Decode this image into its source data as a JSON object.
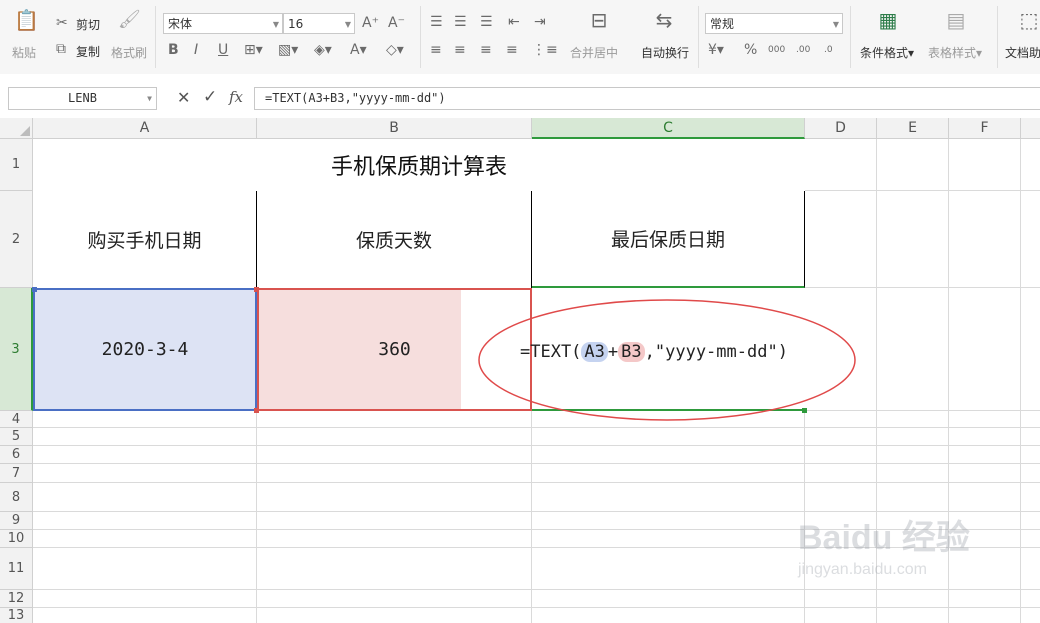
{
  "ribbon": {
    "clipboard": {
      "paste": "粘贴",
      "cut": "剪切",
      "copy": "复制",
      "format_painter": "格式刷"
    },
    "font": {
      "name": "宋体",
      "size": "16"
    },
    "alignment": {
      "merge": "合并居中",
      "wrap": "自动换行"
    },
    "number": {
      "format": "常规"
    },
    "styles": {
      "conditional": "条件格式",
      "table_style": "表格样式",
      "doc": "文档助"
    }
  },
  "formula_bar": {
    "name_box": "LENB",
    "formula": "=TEXT(A3+B3,\"yyyy-mm-dd\")"
  },
  "columns": [
    "A",
    "B",
    "C",
    "D",
    "E",
    "F"
  ],
  "rows": [
    "1",
    "2",
    "3",
    "4",
    "5",
    "6",
    "7",
    "8",
    "9",
    "10",
    "11",
    "12",
    "13"
  ],
  "sheet": {
    "title": "手机保质期计算表",
    "headers": [
      "购买手机日期",
      "保质天数",
      "最后保质日期"
    ],
    "a3": "2020-3-4",
    "b3": "360",
    "c3": {
      "prefix": "=TEXT(",
      "ref1": "A3",
      "plus": "+",
      "ref2": "B3",
      "suffix": ",\"yyyy-mm-dd\")"
    }
  },
  "colors": {
    "ref1": "#c5d3f0",
    "ref2": "#f4c8c8",
    "a3_fill": "#dde3f4",
    "b3_fill": "#f6dedd",
    "annotation": "#e04a4a",
    "active": "#2e9a3c"
  },
  "watermark": {
    "brand": "Baidu 经验",
    "url": "jingyan.baidu.com"
  }
}
